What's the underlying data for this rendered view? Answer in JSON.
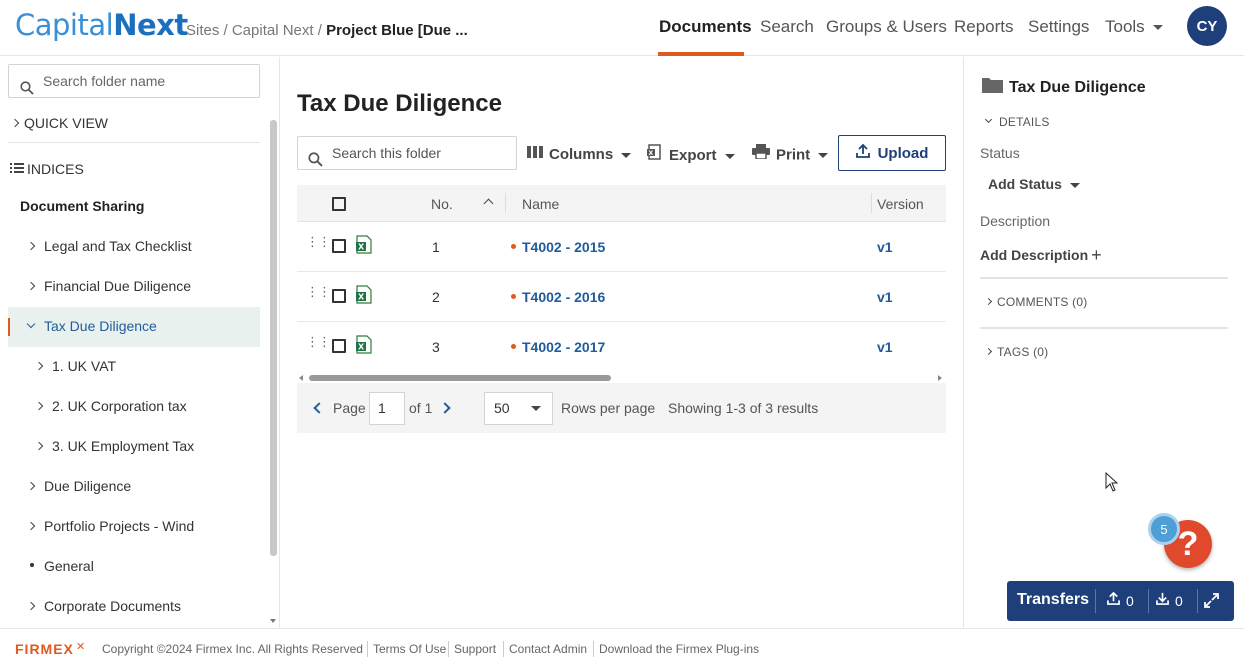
{
  "header": {
    "logo_part1": "Capital",
    "logo_part2": "Next",
    "breadcrumb_prefix": "Sites / Capital Next /",
    "breadcrumb_current": "Project Blue [Due ...",
    "nav": [
      "Documents",
      "Search",
      "Groups & Users",
      "Reports",
      "Settings",
      "Tools"
    ],
    "active_nav": "Documents",
    "avatar_initials": "CY",
    "accent": "#e05a1e",
    "brand": "#1f3f7a"
  },
  "sidebar": {
    "search_placeholder": "Search folder name",
    "quick_view": "QUICK VIEW",
    "indices": "INDICES",
    "section": "Document Sharing",
    "items": [
      {
        "label": "Legal and Tax Checklist",
        "icon": "chevron-right"
      },
      {
        "label": "Financial Due Diligence",
        "icon": "chevron-right"
      },
      {
        "label": "Tax Due Diligence",
        "icon": "chevron-down",
        "active": true
      },
      {
        "label": "1. UK VAT",
        "icon": "chevron-right"
      },
      {
        "label": "2. UK Corporation tax",
        "icon": "chevron-right"
      },
      {
        "label": "3. UK Employment Tax",
        "icon": "chevron-right"
      },
      {
        "label": "Due Diligence",
        "icon": "chevron-right"
      },
      {
        "label": "Portfolio Projects - Wind",
        "icon": "chevron-right"
      },
      {
        "label": "General",
        "icon": "bullet"
      },
      {
        "label": "Corporate Documents",
        "icon": "chevron-right"
      }
    ]
  },
  "main": {
    "title": "Tax Due Diligence",
    "search_placeholder": "Search this folder",
    "toolbar": {
      "columns": "Columns",
      "export": "Export",
      "print": "Print",
      "upload": "Upload"
    },
    "table": {
      "headers": {
        "no": "No.",
        "name": "Name",
        "version": "Version"
      },
      "rows": [
        {
          "no": "1",
          "name": "T4002 - 2015",
          "version": "v1"
        },
        {
          "no": "2",
          "name": "T4002 - 2016",
          "version": "v1"
        },
        {
          "no": "3",
          "name": "T4002 - 2017",
          "version": "v1"
        }
      ]
    },
    "pager": {
      "page_label": "Page",
      "page_value": "1",
      "of_label": "of 1",
      "rows_value": "50",
      "rows_label": "Rows per page",
      "summary": "Showing 1-3 of 3 results"
    }
  },
  "details": {
    "title": "Tax Due Diligence",
    "details_label": "DETAILS",
    "status_label": "Status",
    "status_value": "Add Status",
    "description_label": "Description",
    "description_value": "Add Description",
    "comments": "COMMENTS (0)",
    "tags": "TAGS (0)"
  },
  "footer": {
    "logo": "FIRMEX",
    "copyright": "Copyright ©2024 Firmex Inc. All Rights Reserved",
    "links": [
      "Terms Of Use",
      "Support",
      "Contact Admin",
      "Download the Firmex Plug-ins"
    ]
  },
  "transfers": {
    "label": "Transfers",
    "uploads": "0",
    "downloads": "0"
  },
  "help": {
    "badge_count": "5",
    "symbol": "?"
  }
}
